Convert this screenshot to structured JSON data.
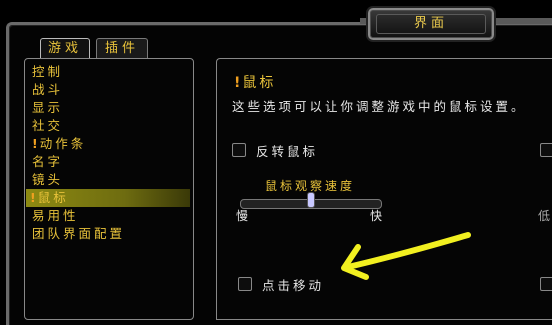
{
  "window": {
    "title": "界面"
  },
  "tabs": [
    {
      "label": "游戏",
      "active": true
    },
    {
      "label": "插件",
      "active": false
    }
  ],
  "categories": [
    {
      "label": "控制",
      "warning": false,
      "selected": false
    },
    {
      "label": "战斗",
      "warning": false,
      "selected": false
    },
    {
      "label": "显示",
      "warning": false,
      "selected": false
    },
    {
      "label": "社交",
      "warning": false,
      "selected": false
    },
    {
      "label": "动作条",
      "warning": true,
      "selected": false
    },
    {
      "label": "名字",
      "warning": false,
      "selected": false
    },
    {
      "label": "镜头",
      "warning": false,
      "selected": false
    },
    {
      "label": "鼠标",
      "warning": true,
      "selected": true
    },
    {
      "label": "易用性",
      "warning": false,
      "selected": false
    },
    {
      "label": "团队界面配置",
      "warning": false,
      "selected": false
    }
  ],
  "panel": {
    "title": "鼠标",
    "description": "这些选项可以让你调整游戏中的鼠标设置。",
    "options": {
      "invert_mouse": {
        "label": "反转鼠标",
        "checked": false
      },
      "click_to_move": {
        "label": "点击移动",
        "checked": false
      }
    },
    "mouse_look_speed": {
      "label": "鼠标观察速度",
      "min_label": "慢",
      "max_label": "快",
      "value": 0.5
    },
    "clipped_right_label": "低"
  },
  "annotation": {
    "color": "#f2f020",
    "shape": "hand-drawn-arrow"
  },
  "colors": {
    "gold_text": "#e8c23a",
    "selection": "#8d8a12",
    "warning": "#f0a020"
  }
}
